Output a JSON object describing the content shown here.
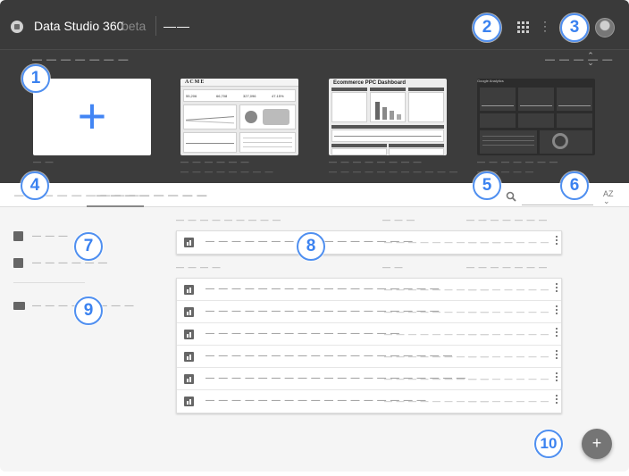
{
  "header": {
    "app_title": "Data Studio 360",
    "beta_label": "beta",
    "page_label": "——",
    "icons": [
      "logo-icon",
      "apps-grid-icon",
      "more-vert-icon",
      "account-avatar"
    ]
  },
  "gallery": {
    "heading": "— — — — — — —",
    "sort_label": "— — — — —",
    "templates": [
      {
        "name": "blank",
        "label": "— —",
        "sub": ""
      },
      {
        "name": "acme",
        "brand": "ACME",
        "label": "— — — — — —",
        "sub": "— — — — — — — —"
      },
      {
        "name": "ecommerce-ppc",
        "title": "Ecommerce PPC Dashboard",
        "label": "— — — — — — — —",
        "sub": "— — — — — — — — — — —"
      },
      {
        "name": "google-analytics",
        "title": "Google Analytics",
        "label": "— — — — — — —",
        "sub": "— — — — —"
      }
    ]
  },
  "tabs": [
    {
      "label": "— — — — — — — — —",
      "active": false
    },
    {
      "label": "— — — — — — — —",
      "active": true
    },
    {
      "label": "— —",
      "active": false
    }
  ],
  "toolbar": {
    "search_placeholder": "",
    "sort_icon": "AZ"
  },
  "sidebar": {
    "items": [
      {
        "label": "— — —",
        "icon": "bar-chart-icon"
      },
      {
        "label": "— — — — — —",
        "icon": "list-icon"
      },
      {
        "label": "— — — — — — — —",
        "icon": "video-icon"
      }
    ]
  },
  "sections": [
    {
      "header": {
        "name": "— — — — — — — — —",
        "owner": "— — —",
        "date": "— — — — — — —"
      },
      "rows": [
        {
          "name": "— — — — — — — — — — — — — — — —",
          "owner": "— — — — — — — — — —",
          "date": "— — — — — — —"
        }
      ]
    },
    {
      "header": {
        "name": "— — — —",
        "owner": "— —",
        "date": "— — — — — — —"
      },
      "rows": [
        {
          "name": "— — — — — — — — — — — — — — — — — —",
          "owner": "— — — — — — — — —",
          "date": "— — — — — — —"
        },
        {
          "name": "— — — — — — — — — — — — — — — — — —",
          "owner": "— — — — — — — — —",
          "date": "— — — — — — —"
        },
        {
          "name": "— — — — — — — — — — — — — — —",
          "owner": "— — — — — — — — —",
          "date": "— — — — — — —"
        },
        {
          "name": "— — — — — — — — — — — — — — — — — — —",
          "owner": "— — — — — — — — —",
          "date": "— — — — — — —"
        },
        {
          "name": "— — — — — — — — — — — — — — — — — — — —",
          "owner": "— — — — — — — — —",
          "date": "— — — — — — —"
        },
        {
          "name": "— — — — — — — — — — — — — — — — —",
          "owner": "— — — — — — — — —",
          "date": "— — — — — — —"
        }
      ]
    }
  ],
  "fab": {
    "label": "+"
  },
  "callouts": [
    "1",
    "2",
    "3",
    "4",
    "5",
    "6",
    "7",
    "8",
    "9",
    "10"
  ],
  "colors": {
    "topbar": "#3a3a3a",
    "gallery": "#3c3c3c",
    "accent_plus": "#4285f4",
    "callout": "#4f8ff0",
    "fab": "#757575"
  }
}
